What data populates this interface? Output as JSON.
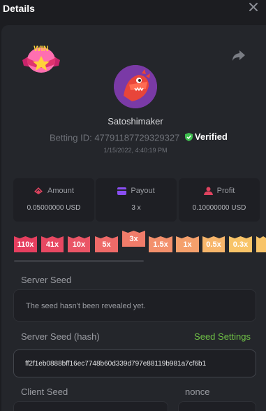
{
  "header": {
    "title": "Details"
  },
  "player": {
    "username": "Satoshimaker",
    "betting_id_label": "Betting ID:",
    "betting_id": "47791187729329327",
    "verified_label": "Verified",
    "timestamp": "1/15/2022, 4:40:19 PM"
  },
  "badge": {
    "text": "WIN"
  },
  "stats": [
    {
      "label": "Amount",
      "value": "0.05000000 USD",
      "icon": "cash-icon"
    },
    {
      "label": "Payout",
      "value": "3 x",
      "icon": "card-icon"
    },
    {
      "label": "Profit",
      "value": "0.10000000 USD",
      "icon": "profit-icon"
    }
  ],
  "multipliers": [
    {
      "label": "110x",
      "color": "#e63f5f"
    },
    {
      "label": "41x",
      "color": "#e84862"
    },
    {
      "label": "10x",
      "color": "#ea5566"
    },
    {
      "label": "5x",
      "color": "#ee6a68"
    },
    {
      "label": "3x",
      "color": "#f07c6a",
      "active": true
    },
    {
      "label": "1.5x",
      "color": "#f3906c"
    },
    {
      "label": "1x",
      "color": "#f5a06c"
    },
    {
      "label": "0.5x",
      "color": "#f7b66b"
    },
    {
      "label": "0.3x",
      "color": "#f8c468"
    }
  ],
  "server_seed": {
    "label": "Server Seed",
    "message": "The seed hasn't been revealed yet."
  },
  "server_seed_hash": {
    "label": "Server Seed (hash)",
    "link": "Seed Settings",
    "value": "ff2f1eb0888bff16ec7748b60d339d797e88119b981a7cf6b1"
  },
  "client_seed": {
    "label": "Client Seed"
  },
  "nonce": {
    "label": "nonce"
  },
  "colors": {
    "accent_green": "#6fc146",
    "panel": "#24262b",
    "background": "#1c1d21"
  }
}
